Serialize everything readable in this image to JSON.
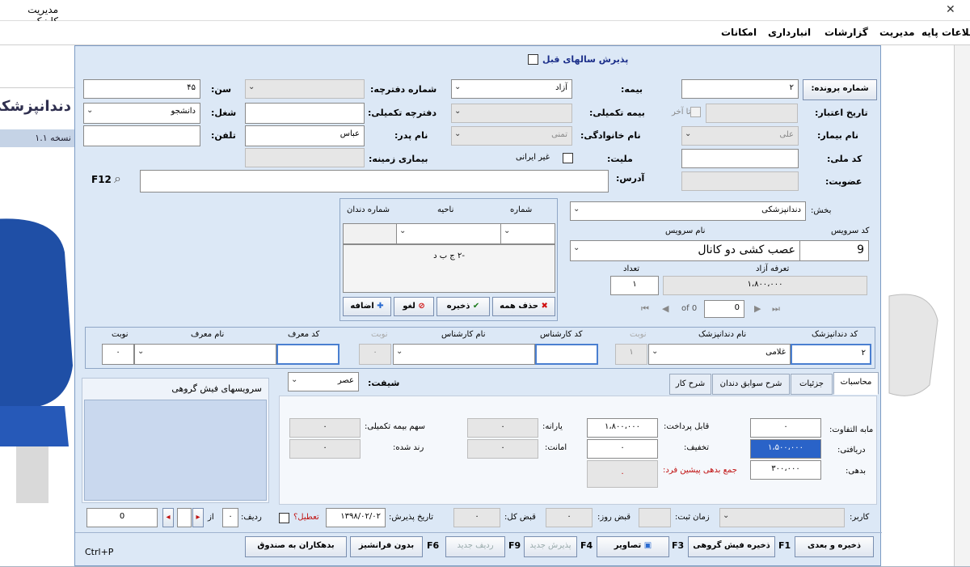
{
  "window": {
    "title": "مدیریت کلینیک"
  },
  "menu": [
    "امکانات",
    "انبارداری",
    "گزارشات",
    "مدیریت",
    "اطلاعات پایه"
  ],
  "background": {
    "banner_title": "دندانپزشکی",
    "version": "نسخه ۱.۱"
  },
  "dialog": {
    "prev_years_label": "پذیرش سالهای قبل",
    "file_no_button": "شماره پرونده:",
    "file_no": "۲",
    "validity_label": "تاریخ اعتبار:",
    "until_label": "تا آخر",
    "patient_name_label": "نام بیمار:",
    "patient_name": "علی",
    "national_code_label": "کد ملی:",
    "membership_label": "عضویت:",
    "insurance_label": "بیمه:",
    "insurance": "آزاد",
    "supp_insurance_label": "بیمه تکمیلی:",
    "family_name_label": "نام خانوادگی:",
    "family_name": "تمنی",
    "nationality_label": "ملیت:",
    "non_iranian_label": "غیر ایرانی",
    "address_label": "آدرس:",
    "booklet_no_label": "شماره دفترچه:",
    "supp_booklet_label": "دفترچه تکمیلی:",
    "father_name_label": "نام پدر:",
    "father_name": "عباس",
    "background_disease_label": "بیماری زمینه:",
    "age_label": "سن:",
    "age": "۴۵",
    "job_label": "شغل:",
    "job": "دانشجو",
    "phone_label": "تلفن:",
    "search_key": "F12"
  },
  "service": {
    "section_label": "بخش:",
    "section": "دندانپزشکی",
    "code_label": "کد سرویس",
    "name_label": "نام سرویس",
    "code": "9",
    "name": "عصب کشی دو کانال",
    "count_label": "تعداد",
    "count": "۱",
    "tariff_label": "تعرفه آزاد",
    "tariff": "۱،۸۰۰،۰۰۰",
    "nav_of": "of 0",
    "nav_pos": "0"
  },
  "tooth": {
    "number_label": "شماره",
    "area_label": "ناحیه",
    "tooth_number_label": "شماره دندان",
    "list_item": "-۲ ج ب د",
    "delete_all": "حذف همه",
    "save": "ذخیره",
    "cancel": "لغو",
    "add": "اضافه"
  },
  "staff": {
    "dentist_code_label": "کد دندانپزشک",
    "dentist_code": "۲",
    "dentist_name_label": "نام دندانپزشک",
    "dentist_name": "غلامی",
    "turn_label": "نوبت",
    "turn1": "۱",
    "expert_code_label": "کد کارشناس",
    "expert_name_label": "نام کارشناس",
    "turn2": "۰",
    "referrer_code_label": "کد معرف",
    "referrer_name_label": "نام معرف",
    "turn3": "۰"
  },
  "tabs": [
    "محاسبات",
    "جزئیات",
    "شرح سوابق دندان",
    "شرح کار"
  ],
  "shift": {
    "label": "شیفت:",
    "value": "عصر"
  },
  "group_services_title": "سرویسهای فیش گروهی",
  "calc": {
    "difference_label": "مابه التفاوت:",
    "difference": "۰",
    "received_label": "دریافتی:",
    "received": "۱،۵۰۰،۰۰۰",
    "debt_label": "بدهی:",
    "debt": "۳۰۰،۰۰۰",
    "payable_label": "قابل پرداخت:",
    "payable": "۱،۸۰۰،۰۰۰",
    "discount_label": "تخفیف:",
    "discount": "۰",
    "total_debt_label": "جمع بدهی پیشین فرد:",
    "total_debt": "۰",
    "subsidy_label": "یارانه:",
    "subsidy": "۰",
    "deposit_label": "امانت:",
    "deposit": "۰",
    "supp_share_label": "سهم بیمه تکمیلی:",
    "supp_share": "۰",
    "rounded_label": "رند شده:",
    "rounded": "۰"
  },
  "status": {
    "user_label": "کاربر:",
    "register_time_label": "زمان ثبت:",
    "day_receipt_label": "قبض روز:",
    "day_receipt": "۰",
    "total_receipt_label": "قبض کل:",
    "total_receipt": "۰",
    "admit_date_label": "تاریخ پذیرش:",
    "admit_date": "۱۳۹۸/۰۲/۰۲",
    "holiday_label": "تعطیل؟",
    "row_label": "ردیف:",
    "row": "۰",
    "of_label": "از",
    "total": "0"
  },
  "footer": {
    "save_next": "ذخیره و بعدی",
    "f1": "F1",
    "save_group": "ذخیره فیش گروهی",
    "f3": "F3",
    "images": "تصاویر",
    "f4": "F4",
    "new_admit": "پذیرش جدید",
    "f9": "F9",
    "new_row": "ردیف جدید",
    "f6": "F6",
    "no_franchise": "بدون فرانشیز",
    "debtors": "بدهکاران به صندوق",
    "print_key": "Ctrl+P"
  }
}
